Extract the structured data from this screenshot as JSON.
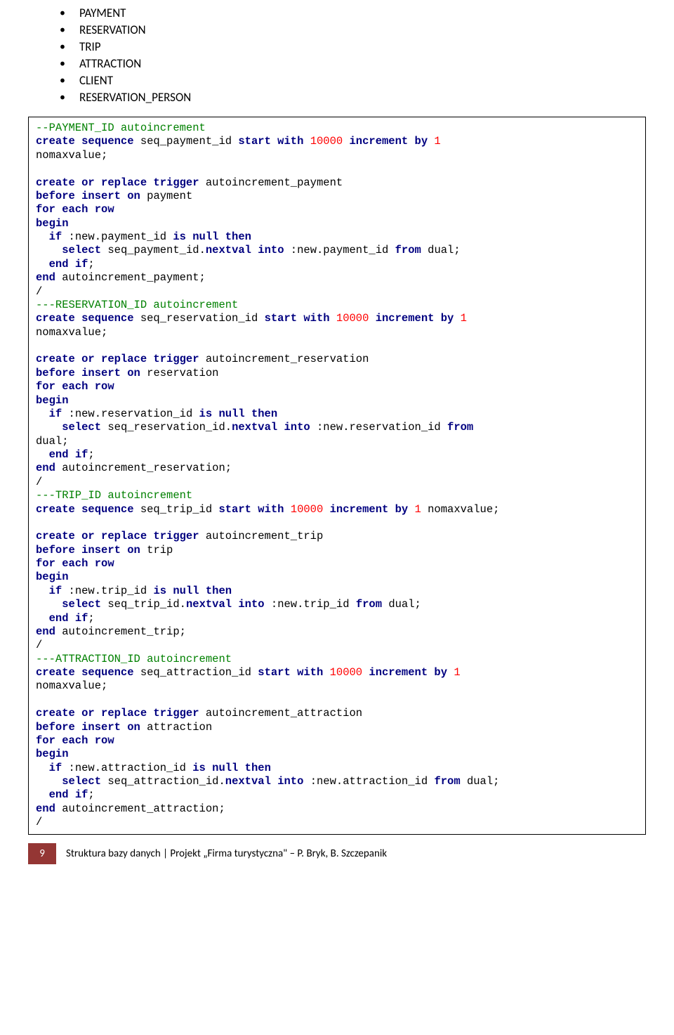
{
  "bullets": {
    "b1": "PAYMENT",
    "b2": "RESERVATION",
    "b3": "TRIP",
    "b4": "ATTRACTION",
    "b5": "CLIENT",
    "b6": "RESERVATION_PERSON"
  },
  "code": {
    "c1": "--PAYMENT_ID autoincrement",
    "c2a": "create sequence ",
    "c2b": "seq_payment_id ",
    "c2c": "start with ",
    "c2d": "10000 ",
    "c2e": "increment by ",
    "c2f": "1",
    "c3": "nomaxvalue;",
    "c4": "",
    "c5a": "create or replace trigger ",
    "c5b": "autoincrement_payment",
    "c6a": "before insert on ",
    "c6b": "payment",
    "c7": "for each row",
    "c8": "begin",
    "c9a": "  if ",
    "c9b": ":new.payment_id ",
    "c9c": "is null then",
    "c10a": "    select ",
    "c10b": "seq_payment_id.",
    "c10c": "nextval into ",
    "c10d": ":new.payment_id ",
    "c10e": "from ",
    "c10f": "dual;",
    "c11a": "  end if",
    "c11b": ";",
    "c12a": "end ",
    "c12b": "autoincrement_payment;",
    "c13": "/",
    "c14": "---RESERVATION_ID autoincrement",
    "c15a": "create sequence ",
    "c15b": "seq_reservation_id ",
    "c15c": "start with ",
    "c15d": "10000 ",
    "c15e": "increment by ",
    "c15f": "1",
    "c16": "nomaxvalue;",
    "c17": "",
    "c18a": "create or replace trigger ",
    "c18b": "autoincrement_reservation",
    "c19a": "before insert on ",
    "c19b": "reservation",
    "c20": "for each row",
    "c21": "begin",
    "c22a": "  if ",
    "c22b": ":new.reservation_id ",
    "c22c": "is null then",
    "c23a": "    select ",
    "c23b": "seq_reservation_id.",
    "c23c": "nextval into ",
    "c23d": ":new.reservation_id ",
    "c23e": "from",
    "c24": "dual;",
    "c25a": "  end if",
    "c25b": ";",
    "c26a": "end ",
    "c26b": "autoincrement_reservation;",
    "c27": "/",
    "c28": "---TRIP_ID autoincrement",
    "c29a": "create sequence ",
    "c29b": "seq_trip_id ",
    "c29c": "start with ",
    "c29d": "10000 ",
    "c29e": "increment by ",
    "c29f": "1 ",
    "c29g": "nomaxvalue;",
    "c30": "",
    "c31a": "create or replace trigger ",
    "c31b": "autoincrement_trip",
    "c32a": "before insert on ",
    "c32b": "trip",
    "c33": "for each row",
    "c34": "begin",
    "c35a": "  if ",
    "c35b": ":new.trip_id ",
    "c35c": "is null then",
    "c36a": "    select ",
    "c36b": "seq_trip_id.",
    "c36c": "nextval into ",
    "c36d": ":new.trip_id ",
    "c36e": "from ",
    "c36f": "dual;",
    "c37a": "  end if",
    "c37b": ";",
    "c38a": "end ",
    "c38b": "autoincrement_trip;",
    "c39": "/",
    "c40": "---ATTRACTION_ID autoincrement",
    "c41a": "create sequence ",
    "c41b": "seq_attraction_id ",
    "c41c": "start with ",
    "c41d": "10000 ",
    "c41e": "increment by ",
    "c41f": "1",
    "c42": "nomaxvalue;",
    "c43": "",
    "c44a": "create or replace trigger ",
    "c44b": "autoincrement_attraction",
    "c45a": "before insert on ",
    "c45b": "attraction",
    "c46": "for each row",
    "c47": "begin",
    "c48a": "  if ",
    "c48b": ":new.attraction_id ",
    "c48c": "is null then",
    "c49a": "    select ",
    "c49b": "seq_attraction_id.",
    "c49c": "nextval into ",
    "c49d": ":new.attraction_id ",
    "c49e": "from ",
    "c49f": "dual;",
    "c50a": "  end if",
    "c50b": ";",
    "c51a": "end ",
    "c51b": "autoincrement_attraction;",
    "c52": "/"
  },
  "footer": {
    "pageNum": "9",
    "text": "Struktura bazy danych | Projekt „Firma turystyczna\" – P. Bryk, B. Szczepanik"
  }
}
